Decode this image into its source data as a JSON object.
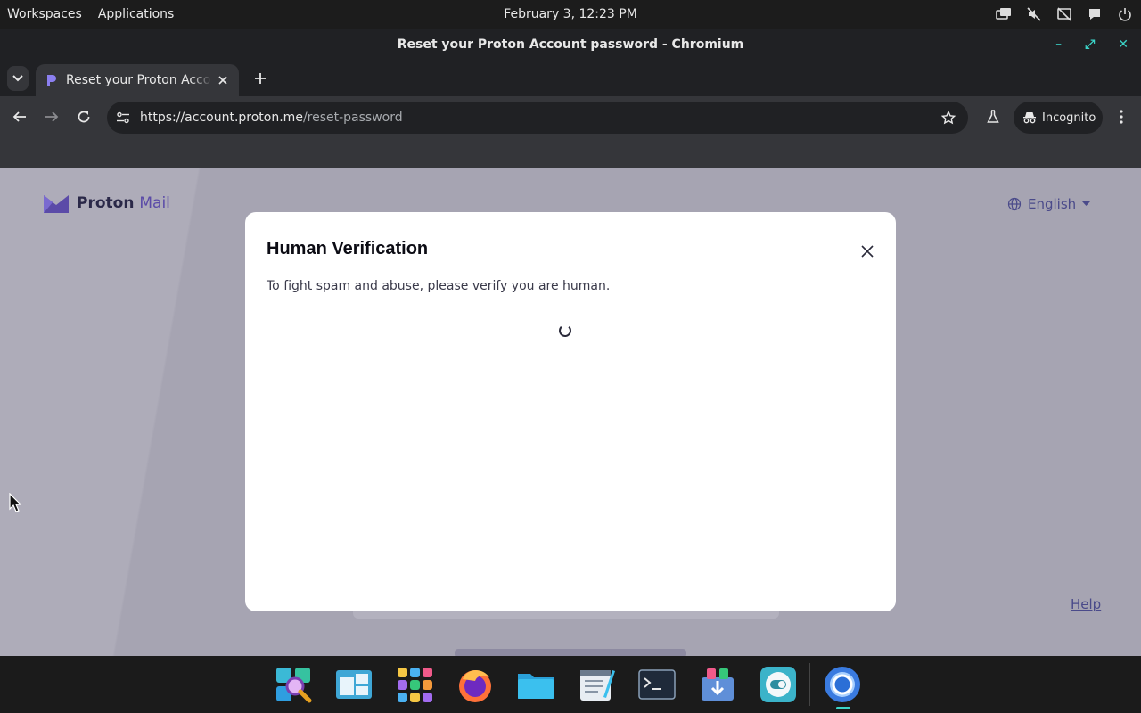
{
  "system": {
    "workspaces": "Workspaces",
    "applications": "Applications",
    "clock": "February 3, 12:23 PM",
    "tray_icons": [
      "screens-icon",
      "mute-icon",
      "no-display-icon",
      "chat-icon",
      "power-icon"
    ]
  },
  "window": {
    "title": "Reset your Proton Account password - Chromium",
    "controls": [
      "minimize-icon",
      "maximize-icon",
      "close-icon"
    ],
    "accent": "#3bd4c8"
  },
  "browser": {
    "tab": {
      "label": "Reset your Proton Account password",
      "favicon": "proton-icon"
    },
    "url_host": "https://account.proton.me",
    "url_path": "/reset-password",
    "incognito_label": "Incognito"
  },
  "page": {
    "brand": "Proton",
    "brand_product": "Mail",
    "language": "English",
    "help_link": "Help",
    "background": "#a6a4b2"
  },
  "modal": {
    "title": "Human Verification",
    "description": "To fight spam and abuse, please verify you are human."
  },
  "dock": {
    "items": [
      "search-magnifier-icon",
      "window-manager-icon",
      "app-grid-icon",
      "firefox-icon",
      "files-folder-icon",
      "text-editor-icon",
      "terminal-icon",
      "software-installer-icon",
      "toggle-settings-icon",
      "chromium-icon"
    ]
  }
}
